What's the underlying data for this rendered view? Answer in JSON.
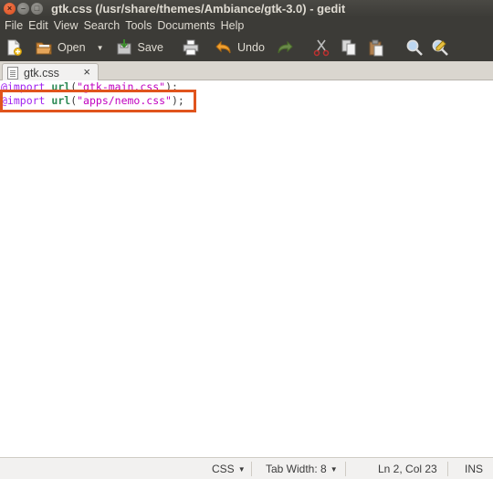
{
  "window": {
    "title": "gtk.css (/usr/share/themes/Ambiance/gtk-3.0) - gedit",
    "controls": {
      "close": "×",
      "minimize": "–",
      "maximize": "□"
    }
  },
  "menu": [
    "File",
    "Edit",
    "View",
    "Search",
    "Tools",
    "Documents",
    "Help"
  ],
  "toolbar": {
    "open_label": "Open",
    "save_label": "Save",
    "undo_label": "Undo",
    "icons": [
      "new-document-icon",
      "open-folder-icon",
      "dropdown-arrow-icon",
      "save-icon",
      "print-icon",
      "undo-icon",
      "redo-icon",
      "cut-icon",
      "copy-icon",
      "paste-icon",
      "find-icon",
      "replace-icon"
    ]
  },
  "tab": {
    "label": "gtk.css",
    "close": "×"
  },
  "editor": {
    "lines": [
      {
        "keyword": "@import",
        "func": "url",
        "open": "(",
        "string": "\"gtk-main.css\"",
        "close": ");"
      },
      {
        "keyword": "@import",
        "func": "url",
        "open": "(",
        "string": "\"apps/nemo.css\"",
        "close": ");"
      }
    ],
    "highlight_color": "#e0541d"
  },
  "statusbar": {
    "language": "CSS",
    "tab_width": "Tab Width:  8",
    "position": "Ln 2, Col 23",
    "mode": "INS"
  }
}
